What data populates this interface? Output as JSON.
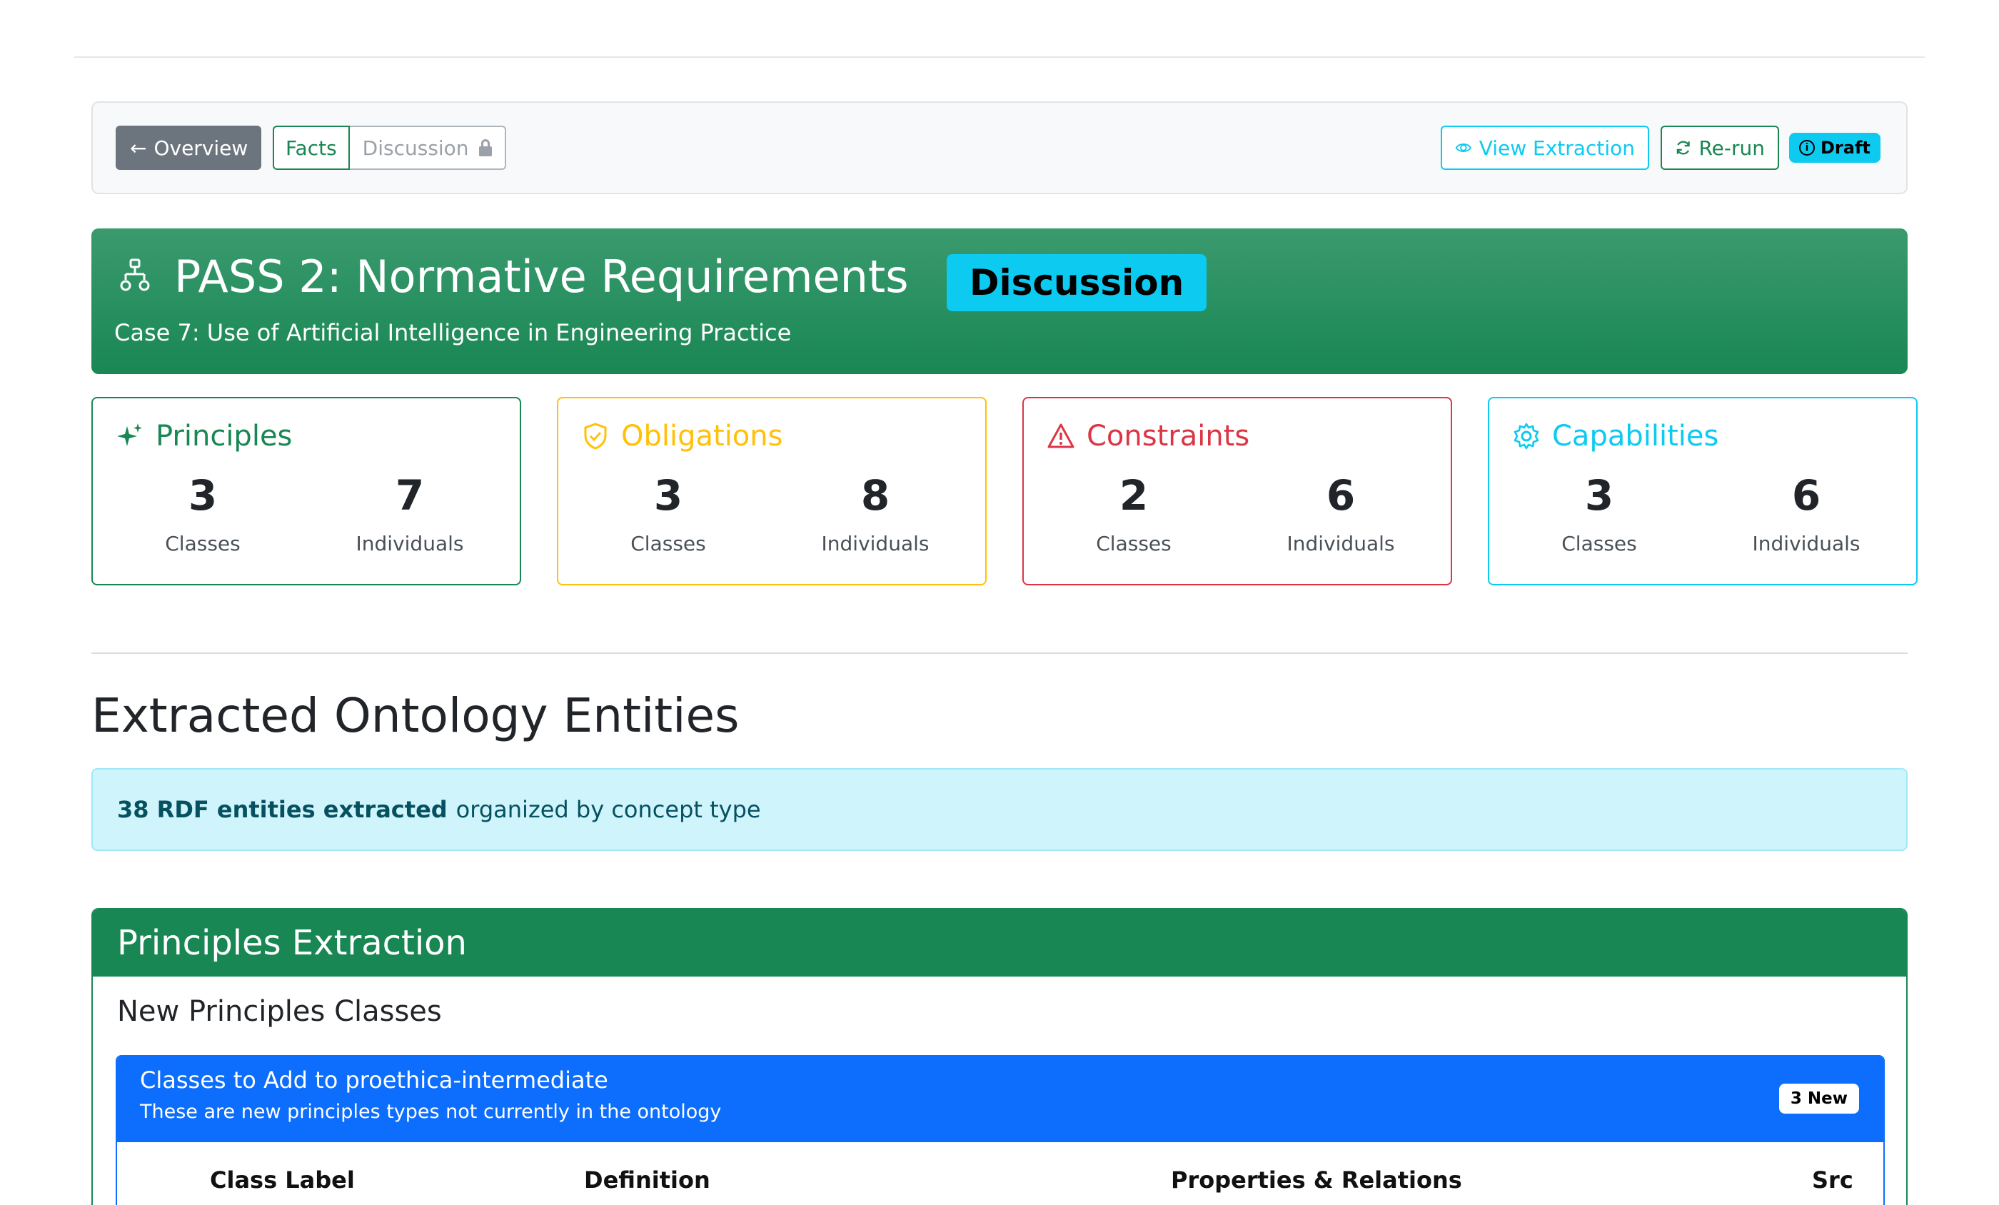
{
  "toolbar": {
    "overview_label": "Overview",
    "facts_label": "Facts",
    "discussion_label": "Discussion",
    "view_extraction_label": "View Extraction",
    "rerun_label": "Re-run",
    "draft_label": "Draft"
  },
  "hero": {
    "title": "PASS 2: Normative Requirements",
    "badge": "Discussion",
    "subtitle": "Case 7: Use of Artificial Intelligence in Engineering Practice"
  },
  "cards": [
    {
      "title": "Principles",
      "classes": "3",
      "individuals": "7",
      "color": "#198754",
      "classes_label": "Classes",
      "individuals_label": "Individuals"
    },
    {
      "title": "Obligations",
      "classes": "3",
      "individuals": "8",
      "color": "#ffc107",
      "classes_label": "Classes",
      "individuals_label": "Individuals"
    },
    {
      "title": "Constraints",
      "classes": "2",
      "individuals": "6",
      "color": "#dc3545",
      "classes_label": "Classes",
      "individuals_label": "Individuals"
    },
    {
      "title": "Capabilities",
      "classes": "3",
      "individuals": "6",
      "color": "#0dcaf0",
      "classes_label": "Classes",
      "individuals_label": "Individuals"
    }
  ],
  "section_title": "Extracted Ontology Entities",
  "alert": {
    "bold": "38 RDF entities extracted",
    "rest": "organized by concept type"
  },
  "principles_panel": {
    "header": "Principles Extraction",
    "subheader": "New Principles Classes",
    "box_title": "Classes to Add to proethica-intermediate",
    "box_subtitle": "These are new principles types not currently in the ontology",
    "new_badge": "3 New",
    "columns": [
      "Class Label",
      "Definition",
      "Properties & Relations",
      "Src"
    ]
  }
}
